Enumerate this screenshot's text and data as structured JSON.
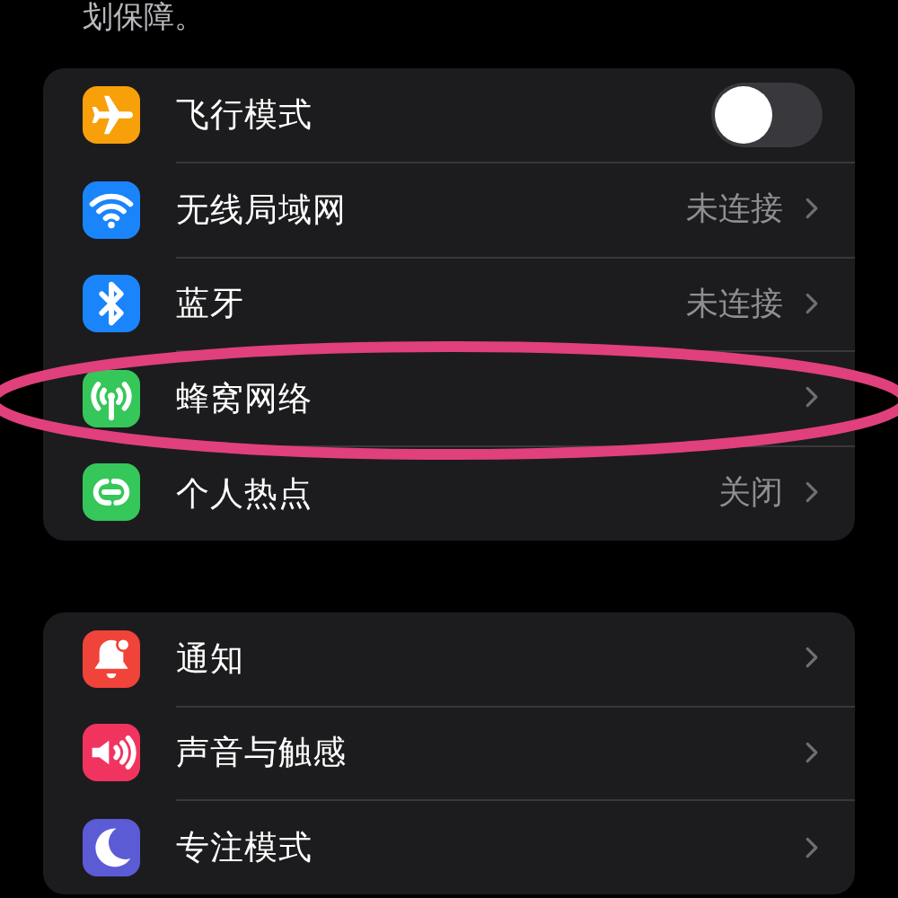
{
  "caption": "划保障。",
  "groups": [
    {
      "rows": [
        {
          "kind": "toggle",
          "color": "#f7a00a",
          "label": "飞行模式",
          "on": false
        },
        {
          "kind": "link",
          "color": "#1a84fb",
          "label": "无线局域网",
          "value": "未连接"
        },
        {
          "kind": "link",
          "color": "#1a84fb",
          "label": "蓝牙",
          "value": "未连接"
        },
        {
          "kind": "link",
          "color": "#35c759",
          "label": "蜂窝网络"
        },
        {
          "kind": "link",
          "color": "#35c759",
          "label": "个人热点",
          "value": "关闭"
        }
      ]
    },
    {
      "rows": [
        {
          "kind": "link",
          "color": "#f0433a",
          "label": "通知"
        },
        {
          "kind": "link",
          "color": "#f1345f",
          "label": "声音与触感"
        },
        {
          "kind": "link",
          "color": "#5c5bd6",
          "label": "专注模式"
        }
      ]
    }
  ],
  "annotation": {
    "kind": "ellipse",
    "color": "#e0407c"
  }
}
